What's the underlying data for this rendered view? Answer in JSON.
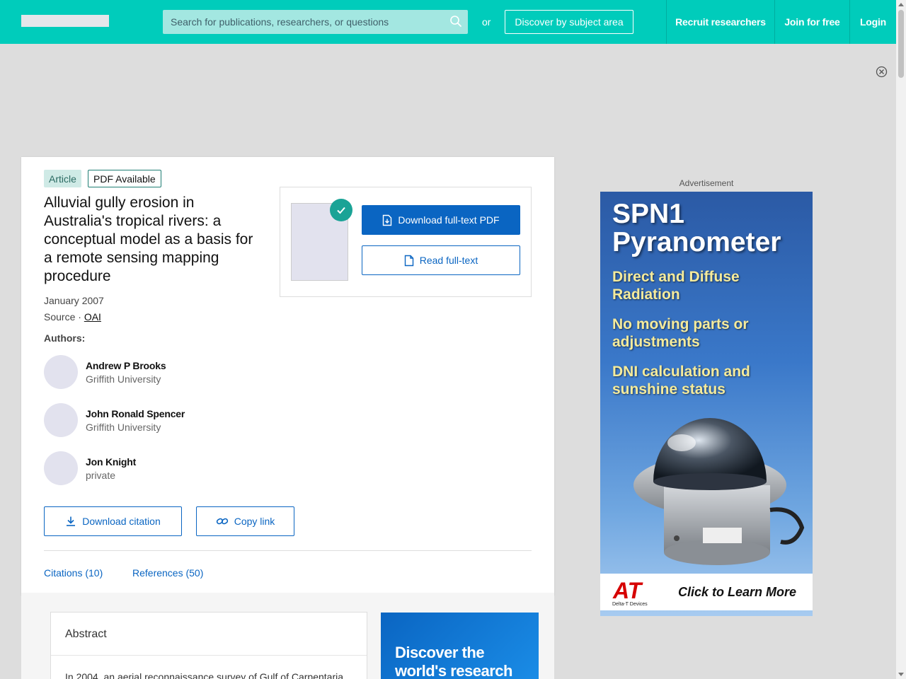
{
  "header": {
    "search_placeholder": "Search for publications, researchers, or questions",
    "or_text": "or",
    "discover_label": "Discover by subject area",
    "nav": {
      "recruit": "Recruit researchers",
      "join": "Join for free",
      "login": "Login"
    }
  },
  "article": {
    "type_badge": "Article",
    "pdf_badge": "PDF Available",
    "title": "Alluvial gully erosion in Australia's tropical rivers: a conceptual model as a basis for a remote sensing mapping procedure",
    "date": "January 2007",
    "source_prefix": "Source · ",
    "source_link": "OAI",
    "authors_label": "Authors:",
    "authors": [
      {
        "name": "Andrew P Brooks",
        "affiliation": "Griffith University"
      },
      {
        "name": "John Ronald Spencer",
        "affiliation": "Griffith University"
      },
      {
        "name": "Jon Knight",
        "affiliation": "private"
      }
    ],
    "download_citation": "Download citation",
    "copy_link": "Copy link",
    "tabs": {
      "citations": "Citations (10)",
      "references": "References (50)"
    }
  },
  "pdf_box": {
    "download_pdf": "Download full-text PDF",
    "read_fulltext": "Read full-text"
  },
  "abstract": {
    "title": "Abstract",
    "text": "In 2004, an aerial reconnaissance survey of Gulf of Carpentaria"
  },
  "discover_promo": {
    "text": "Discover the world's research"
  },
  "ad": {
    "label": "Advertisement",
    "title": "SPN1 Pyranometer",
    "features": [
      "Direct and Diffuse Radiation",
      "No moving parts or adjustments",
      "DNI calculation and sunshine status"
    ],
    "logo": "AT",
    "logo_sub": "Delta-T Devices",
    "cta": "Click to Learn More"
  },
  "colors": {
    "brand": "#00ccbb",
    "primary": "#0a65c2"
  }
}
